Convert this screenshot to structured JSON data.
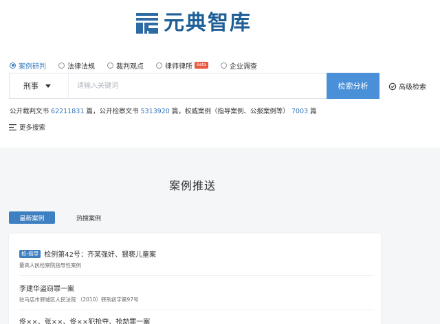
{
  "logo": {
    "name": "元典智库",
    "color": "#1f5f97"
  },
  "categories": [
    {
      "label": "案例研判",
      "selected": true
    },
    {
      "label": "法律法规",
      "selected": false
    },
    {
      "label": "裁判观点",
      "selected": false
    },
    {
      "label": "律师律所",
      "selected": false,
      "badge": "Beta"
    },
    {
      "label": "企业调查",
      "selected": false
    }
  ],
  "search": {
    "type_value": "刑事",
    "placeholder": "请输入关键词",
    "button_label": "检索分析",
    "advanced_label": "高级检索"
  },
  "stats": {
    "part1": "公开裁判文书",
    "judgments_count": "62211831",
    "part2": "篇，公开检察文书",
    "procuratorate_count": "5313920",
    "part3": "篇，权威案例（指导案例、公报案例等）",
    "authority_count": "7003",
    "part4": "篇"
  },
  "more_search_label": "更多搜索",
  "case_push": {
    "title": "案例推送",
    "tabs": [
      {
        "label": "最新案例",
        "active": true
      },
      {
        "label": "热搜案例",
        "active": false
      }
    ],
    "cases": [
      {
        "tag": "检-指导",
        "title": "检例第42号：齐某强奸、猥亵儿童案",
        "source": "最高人民检察院指导性案例"
      },
      {
        "tag": "",
        "title": "李建华盗窃罪一案",
        "source": "驻马店市驿城区人民法院 （2010）驿刑初字第97号"
      },
      {
        "tag": "",
        "title": "佟××、张××、佟××犯抢夺、抢劫罪一案",
        "source": ""
      }
    ]
  },
  "colors": {
    "accent": "#3e7fc1",
    "button": "#4a90d9",
    "number": "#2f72b8",
    "beta_badge": "#e9573f",
    "background_gray": "#f5f6f8"
  }
}
